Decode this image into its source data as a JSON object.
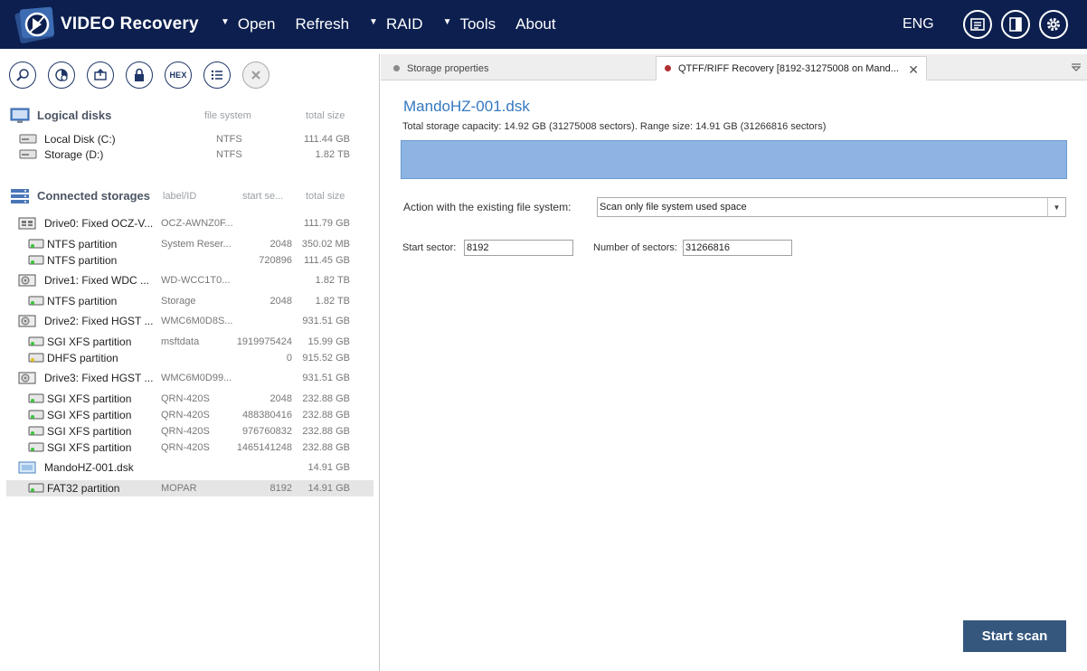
{
  "app": {
    "title": "VIDEO Recovery",
    "menu": [
      {
        "label": "Open",
        "dropdown": true
      },
      {
        "label": "Refresh",
        "dropdown": false
      },
      {
        "label": "RAID",
        "dropdown": true
      },
      {
        "label": "Tools",
        "dropdown": true
      },
      {
        "label": "About",
        "dropdown": false
      }
    ],
    "language": "ENG",
    "dropdown_glyph": "▼"
  },
  "toolbar": {
    "hex_label": "HEX"
  },
  "logical_disks": {
    "title": "Logical disks",
    "col_fs": "file system",
    "col_size": "total size",
    "items": [
      {
        "name": "Local Disk (C:)",
        "fs": "NTFS",
        "size": "111.44 GB"
      },
      {
        "name": "Storage (D:)",
        "fs": "NTFS",
        "size": "1.82 TB"
      }
    ]
  },
  "connected": {
    "title": "Connected storages",
    "col_label": "label/ID",
    "col_start": "start se...",
    "col_size": "total size",
    "rows": [
      {
        "name": "Drive0: Fixed OCZ-V...",
        "label": "OCZ-AWNZ0F...",
        "start": "",
        "size": "111.79 GB"
      },
      {
        "name": "NTFS partition",
        "label": "System Reser...",
        "start": "2048",
        "size": "350.02 MB"
      },
      {
        "name": "NTFS partition",
        "label": "",
        "start": "720896",
        "size": "111.45 GB"
      },
      {
        "name": "Drive1: Fixed WDC ...",
        "label": "WD-WCC1T0...",
        "start": "",
        "size": "1.82 TB"
      },
      {
        "name": "NTFS partition",
        "label": "Storage",
        "start": "2048",
        "size": "1.82 TB"
      },
      {
        "name": "Drive2: Fixed HGST ...",
        "label": "WMC6M0D8S...",
        "start": "",
        "size": "931.51 GB"
      },
      {
        "name": "SGI XFS partition",
        "label": "msftdata",
        "start": "1919975424",
        "size": "15.99 GB"
      },
      {
        "name": "DHFS partition",
        "label": "",
        "start": "0",
        "size": "915.52 GB"
      },
      {
        "name": "Drive3: Fixed HGST ...",
        "label": "WMC6M0D99...",
        "start": "",
        "size": "931.51 GB"
      },
      {
        "name": "SGI XFS partition",
        "label": "QRN-420S",
        "start": "2048",
        "size": "232.88 GB"
      },
      {
        "name": "SGI XFS partition",
        "label": "QRN-420S",
        "start": "488380416",
        "size": "232.88 GB"
      },
      {
        "name": "SGI XFS partition",
        "label": "QRN-420S",
        "start": "976760832",
        "size": "232.88 GB"
      },
      {
        "name": "SGI XFS partition",
        "label": "QRN-420S",
        "start": "1465141248",
        "size": "232.88 GB"
      },
      {
        "name": "MandoHZ-001.dsk",
        "label": "",
        "start": "",
        "size": "14.91 GB"
      },
      {
        "name": "FAT32 partition",
        "label": "MOPAR",
        "start": "8192",
        "size": "14.91 GB"
      }
    ]
  },
  "tabs": [
    {
      "label": "Storage properties",
      "active": false
    },
    {
      "label": "QTFF/RIFF Recovery [8192-31275008 on Mand...",
      "active": true
    }
  ],
  "content": {
    "title": "MandoHZ-001.dsk",
    "capacity": "Total storage capacity: 14.92 GB (31275008 sectors). Range size: 14.91 GB (31266816 sectors)",
    "action_label": "Action with the existing file system:",
    "action_value": "Scan only file system used space",
    "start_label": "Start sector:",
    "start_value": "8192",
    "count_label": "Number of sectors:",
    "count_value": "31266816",
    "start_button": "Start scan"
  },
  "colors": {
    "topbar": "#0c1f4f",
    "accent_blue": "#3478c0",
    "range_bar": "#8db4e2",
    "start_button": "#35577e"
  }
}
